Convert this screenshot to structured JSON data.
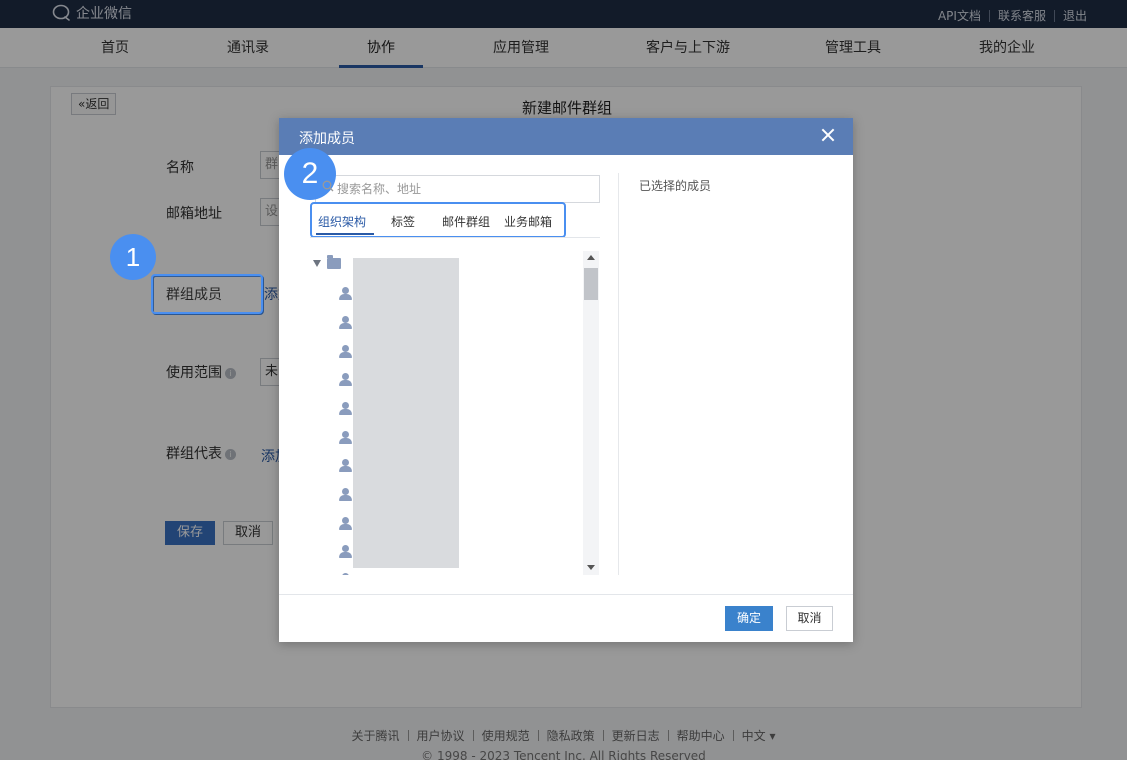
{
  "topbar": {
    "logo_text": "企业微信",
    "links": [
      "API文档",
      "联系客服",
      "退出"
    ]
  },
  "nav": {
    "items": [
      "首页",
      "通讯录",
      "协作",
      "应用管理",
      "客户与上下游",
      "管理工具",
      "我的企业"
    ],
    "active": "协作"
  },
  "page": {
    "back_label": "«返回",
    "title": "新建邮件群组",
    "form": {
      "name_label": "名称",
      "name_value": "群",
      "email_label": "邮箱地址",
      "email_value": "设",
      "members_label": "群组成员",
      "members_link": "添加",
      "scope_label": "使用范围",
      "scope_value": "未",
      "rep_label": "群组代表",
      "rep_link": "添加"
    },
    "save_label": "保存",
    "cancel_label": "取消"
  },
  "modal": {
    "title": "添加成员",
    "search_placeholder": "搜索名称、地址",
    "tabs": [
      "组织架构",
      "标签",
      "邮件群组",
      "业务邮箱"
    ],
    "active_tab": "组织架构",
    "selected_title": "已选择的成员",
    "confirm_label": "确定",
    "cancel_label": "取消"
  },
  "badges": {
    "step1": "1",
    "step2": "2"
  },
  "footer": {
    "links": [
      "关于腾讯",
      "用户协议",
      "使用规范",
      "隐私政策",
      "更新日志",
      "帮助中心",
      "中文 ▾"
    ],
    "copyright": "© 1998 - 2023 Tencent Inc. All Rights Reserved"
  },
  "colors": {
    "topbar": "#1f2d45",
    "modal_header": "#5a7db5",
    "accent": "#4a8ff0",
    "primary_button": "#3a82cc"
  }
}
